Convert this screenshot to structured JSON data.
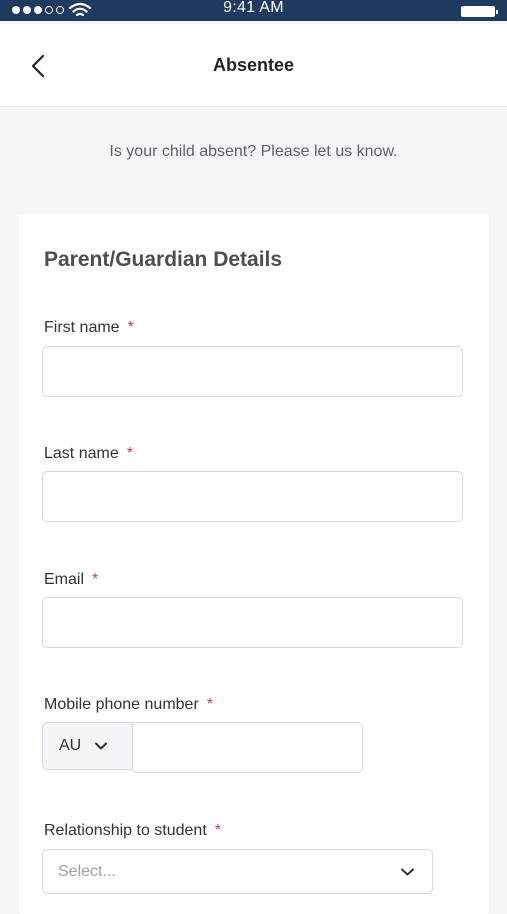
{
  "status_bar": {
    "time": "9:41 AM"
  },
  "nav": {
    "title": "Absentee"
  },
  "intro": {
    "text": "Is your child absent? Please let us know."
  },
  "form": {
    "section_title": "Parent/Guardian Details",
    "required_marker": "*",
    "first_name": {
      "label": "First name",
      "value": ""
    },
    "last_name": {
      "label": "Last name",
      "value": ""
    },
    "email": {
      "label": "Email",
      "value": ""
    },
    "mobile": {
      "label": "Mobile phone number",
      "country_code": "AU",
      "value": ""
    },
    "relationship": {
      "label": "Relationship to student",
      "placeholder": "Select..."
    }
  },
  "colors": {
    "status_bar": "#1e3a5f",
    "required": "#d23a5a",
    "background": "#f5f6f8"
  },
  "icons": [
    "back-chevron-icon",
    "chevron-down-icon",
    "wifi-icon",
    "battery-icon"
  ]
}
